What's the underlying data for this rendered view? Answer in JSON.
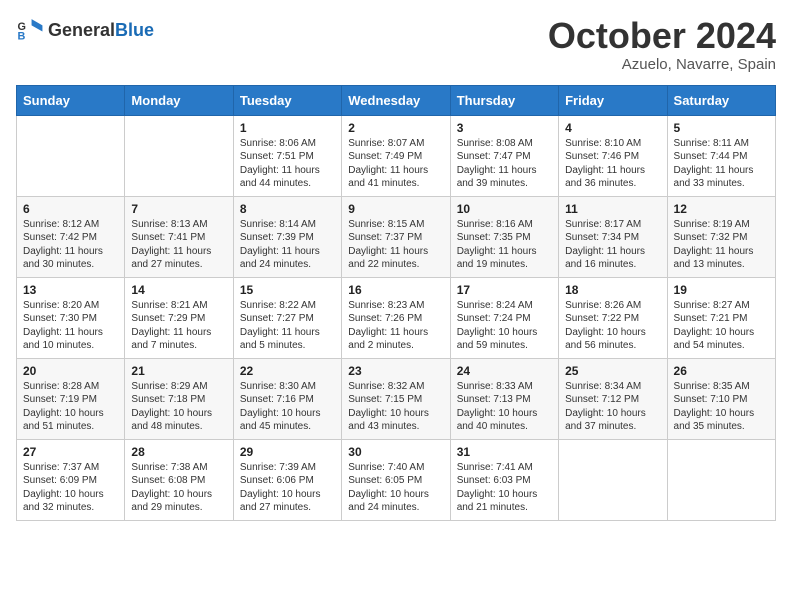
{
  "header": {
    "logo_general": "General",
    "logo_blue": "Blue",
    "month_title": "October 2024",
    "location": "Azuelo, Navarre, Spain"
  },
  "weekdays": [
    "Sunday",
    "Monday",
    "Tuesday",
    "Wednesday",
    "Thursday",
    "Friday",
    "Saturday"
  ],
  "weeks": [
    [
      {
        "day": "",
        "sunrise": "",
        "sunset": "",
        "daylight": ""
      },
      {
        "day": "",
        "sunrise": "",
        "sunset": "",
        "daylight": ""
      },
      {
        "day": "1",
        "sunrise": "Sunrise: 8:06 AM",
        "sunset": "Sunset: 7:51 PM",
        "daylight": "Daylight: 11 hours and 44 minutes."
      },
      {
        "day": "2",
        "sunrise": "Sunrise: 8:07 AM",
        "sunset": "Sunset: 7:49 PM",
        "daylight": "Daylight: 11 hours and 41 minutes."
      },
      {
        "day": "3",
        "sunrise": "Sunrise: 8:08 AM",
        "sunset": "Sunset: 7:47 PM",
        "daylight": "Daylight: 11 hours and 39 minutes."
      },
      {
        "day": "4",
        "sunrise": "Sunrise: 8:10 AM",
        "sunset": "Sunset: 7:46 PM",
        "daylight": "Daylight: 11 hours and 36 minutes."
      },
      {
        "day": "5",
        "sunrise": "Sunrise: 8:11 AM",
        "sunset": "Sunset: 7:44 PM",
        "daylight": "Daylight: 11 hours and 33 minutes."
      }
    ],
    [
      {
        "day": "6",
        "sunrise": "Sunrise: 8:12 AM",
        "sunset": "Sunset: 7:42 PM",
        "daylight": "Daylight: 11 hours and 30 minutes."
      },
      {
        "day": "7",
        "sunrise": "Sunrise: 8:13 AM",
        "sunset": "Sunset: 7:41 PM",
        "daylight": "Daylight: 11 hours and 27 minutes."
      },
      {
        "day": "8",
        "sunrise": "Sunrise: 8:14 AM",
        "sunset": "Sunset: 7:39 PM",
        "daylight": "Daylight: 11 hours and 24 minutes."
      },
      {
        "day": "9",
        "sunrise": "Sunrise: 8:15 AM",
        "sunset": "Sunset: 7:37 PM",
        "daylight": "Daylight: 11 hours and 22 minutes."
      },
      {
        "day": "10",
        "sunrise": "Sunrise: 8:16 AM",
        "sunset": "Sunset: 7:35 PM",
        "daylight": "Daylight: 11 hours and 19 minutes."
      },
      {
        "day": "11",
        "sunrise": "Sunrise: 8:17 AM",
        "sunset": "Sunset: 7:34 PM",
        "daylight": "Daylight: 11 hours and 16 minutes."
      },
      {
        "day": "12",
        "sunrise": "Sunrise: 8:19 AM",
        "sunset": "Sunset: 7:32 PM",
        "daylight": "Daylight: 11 hours and 13 minutes."
      }
    ],
    [
      {
        "day": "13",
        "sunrise": "Sunrise: 8:20 AM",
        "sunset": "Sunset: 7:30 PM",
        "daylight": "Daylight: 11 hours and 10 minutes."
      },
      {
        "day": "14",
        "sunrise": "Sunrise: 8:21 AM",
        "sunset": "Sunset: 7:29 PM",
        "daylight": "Daylight: 11 hours and 7 minutes."
      },
      {
        "day": "15",
        "sunrise": "Sunrise: 8:22 AM",
        "sunset": "Sunset: 7:27 PM",
        "daylight": "Daylight: 11 hours and 5 minutes."
      },
      {
        "day": "16",
        "sunrise": "Sunrise: 8:23 AM",
        "sunset": "Sunset: 7:26 PM",
        "daylight": "Daylight: 11 hours and 2 minutes."
      },
      {
        "day": "17",
        "sunrise": "Sunrise: 8:24 AM",
        "sunset": "Sunset: 7:24 PM",
        "daylight": "Daylight: 10 hours and 59 minutes."
      },
      {
        "day": "18",
        "sunrise": "Sunrise: 8:26 AM",
        "sunset": "Sunset: 7:22 PM",
        "daylight": "Daylight: 10 hours and 56 minutes."
      },
      {
        "day": "19",
        "sunrise": "Sunrise: 8:27 AM",
        "sunset": "Sunset: 7:21 PM",
        "daylight": "Daylight: 10 hours and 54 minutes."
      }
    ],
    [
      {
        "day": "20",
        "sunrise": "Sunrise: 8:28 AM",
        "sunset": "Sunset: 7:19 PM",
        "daylight": "Daylight: 10 hours and 51 minutes."
      },
      {
        "day": "21",
        "sunrise": "Sunrise: 8:29 AM",
        "sunset": "Sunset: 7:18 PM",
        "daylight": "Daylight: 10 hours and 48 minutes."
      },
      {
        "day": "22",
        "sunrise": "Sunrise: 8:30 AM",
        "sunset": "Sunset: 7:16 PM",
        "daylight": "Daylight: 10 hours and 45 minutes."
      },
      {
        "day": "23",
        "sunrise": "Sunrise: 8:32 AM",
        "sunset": "Sunset: 7:15 PM",
        "daylight": "Daylight: 10 hours and 43 minutes."
      },
      {
        "day": "24",
        "sunrise": "Sunrise: 8:33 AM",
        "sunset": "Sunset: 7:13 PM",
        "daylight": "Daylight: 10 hours and 40 minutes."
      },
      {
        "day": "25",
        "sunrise": "Sunrise: 8:34 AM",
        "sunset": "Sunset: 7:12 PM",
        "daylight": "Daylight: 10 hours and 37 minutes."
      },
      {
        "day": "26",
        "sunrise": "Sunrise: 8:35 AM",
        "sunset": "Sunset: 7:10 PM",
        "daylight": "Daylight: 10 hours and 35 minutes."
      }
    ],
    [
      {
        "day": "27",
        "sunrise": "Sunrise: 7:37 AM",
        "sunset": "Sunset: 6:09 PM",
        "daylight": "Daylight: 10 hours and 32 minutes."
      },
      {
        "day": "28",
        "sunrise": "Sunrise: 7:38 AM",
        "sunset": "Sunset: 6:08 PM",
        "daylight": "Daylight: 10 hours and 29 minutes."
      },
      {
        "day": "29",
        "sunrise": "Sunrise: 7:39 AM",
        "sunset": "Sunset: 6:06 PM",
        "daylight": "Daylight: 10 hours and 27 minutes."
      },
      {
        "day": "30",
        "sunrise": "Sunrise: 7:40 AM",
        "sunset": "Sunset: 6:05 PM",
        "daylight": "Daylight: 10 hours and 24 minutes."
      },
      {
        "day": "31",
        "sunrise": "Sunrise: 7:41 AM",
        "sunset": "Sunset: 6:03 PM",
        "daylight": "Daylight: 10 hours and 21 minutes."
      },
      {
        "day": "",
        "sunrise": "",
        "sunset": "",
        "daylight": ""
      },
      {
        "day": "",
        "sunrise": "",
        "sunset": "",
        "daylight": ""
      }
    ]
  ]
}
